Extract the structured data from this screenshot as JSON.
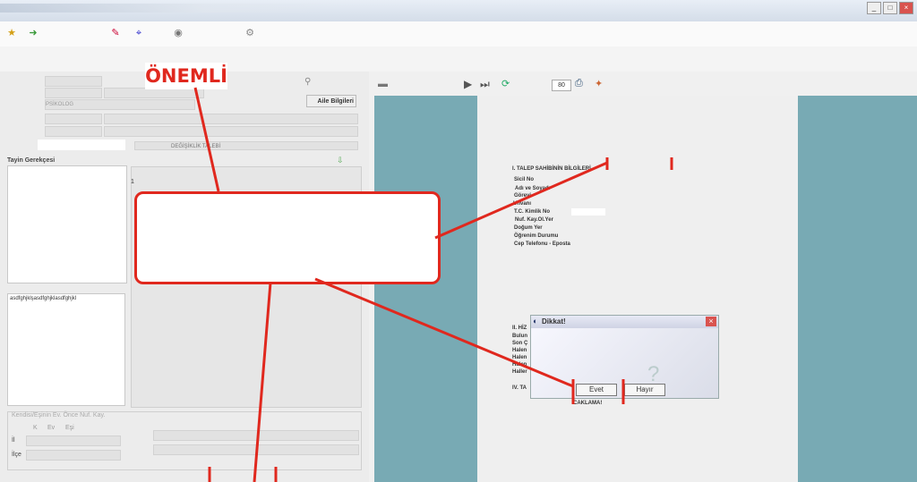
{
  "annotation": {
    "label": "ÖNEMLİ",
    "color": "#e0281e"
  },
  "form": {
    "aile_button": "Aile Bilgileri",
    "psikolog_value": "PSİKOLOG",
    "talep_type": "DEĞİŞİKLİK TALEBİ",
    "tayin_label": "Tayin Gerekçesi",
    "notes_text": "asdfghjklşasdfghjklasdfghjkl",
    "grid_first_row": "1",
    "kurum_label": "Kendisi/Eşinin Ev. Önce Nuf. Kay.",
    "kurum_cols": [
      "K",
      "Ev",
      "Eşi"
    ],
    "il_label": "İl",
    "ilce_label": "İlçe"
  },
  "preview": {
    "zoom_value": "80",
    "section1_title": "I. TALEP SAHİBİNİN BİLGİLERİ",
    "fields": [
      "Sicil No",
      "Adı ve Soyadı",
      "Görevi",
      "Unvanı",
      "T.C. Kimlik No",
      "Nuf. Kay.Ol.Yer",
      "Doğum Yer",
      "Öğrenim Durumu",
      "Cep Telefonu - Eposta"
    ],
    "section2_prefix": "II. HİZ",
    "section2_rows": [
      "Bulun",
      "Son Ç",
      "Halen",
      "Halen",
      "Halen",
      "Haller"
    ],
    "section4_prefix": "IV. TA",
    "bottom_text": "CAKLAMA!"
  },
  "dialog": {
    "title": "Dikkat!",
    "yes_label": "Evet",
    "no_label": "Hayır"
  },
  "colors": {
    "preview_bg": "#78aab4",
    "annotation_red": "#e0281e"
  }
}
